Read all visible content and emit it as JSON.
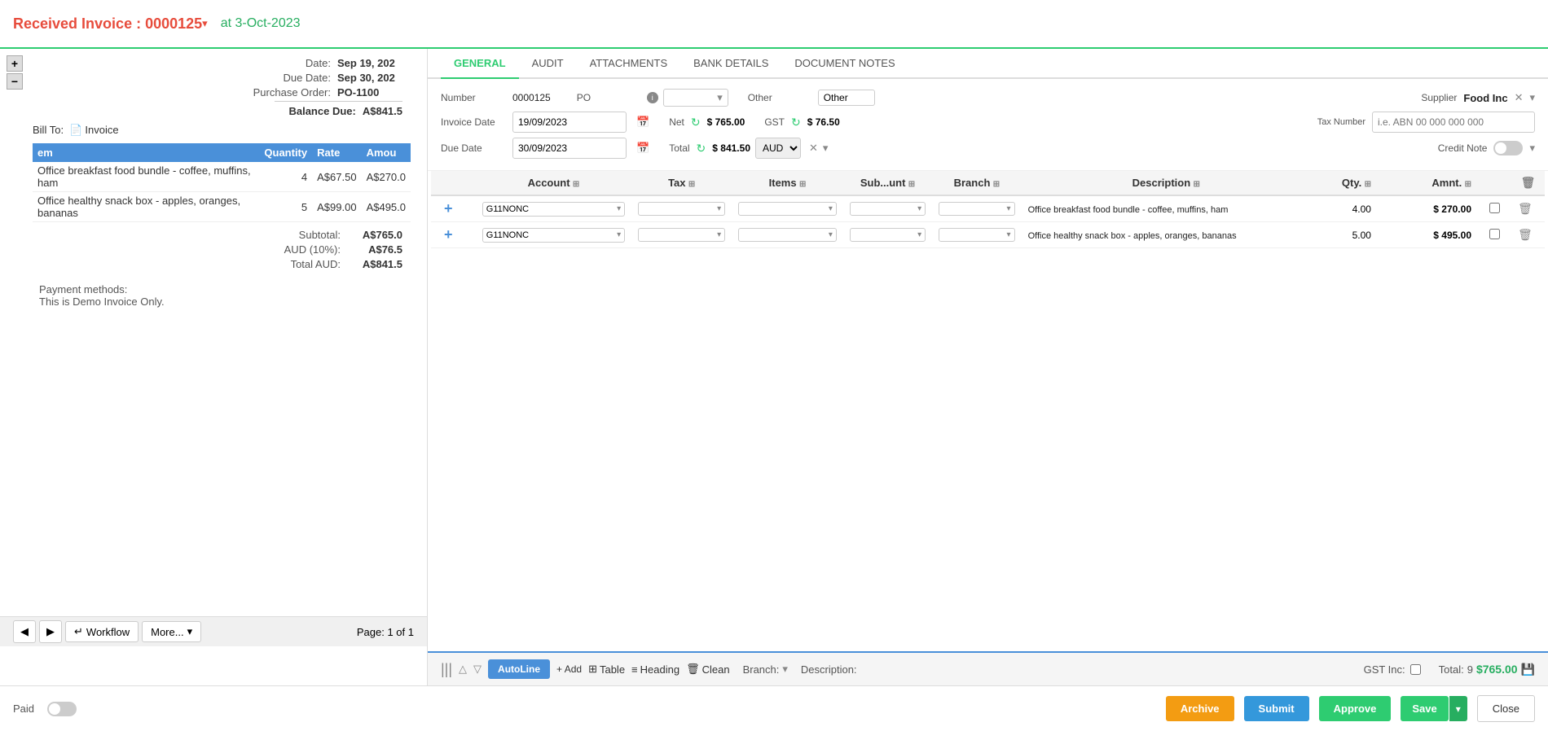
{
  "header": {
    "title": "Received Invoice : 0000125",
    "title_dropdown_symbol": "▾",
    "date": "at 3-Oct-2023"
  },
  "tabs": {
    "items": [
      "GENERAL",
      "AUDIT",
      "ATTACHMENTS",
      "BANK DETAILS",
      "DOCUMENT NOTES"
    ],
    "active": "GENERAL"
  },
  "form": {
    "number_label": "Number",
    "number_value": "0000125",
    "po_label": "PO",
    "po_info": "i",
    "other_label": "Other",
    "other_value": "Other",
    "supplier_label": "Supplier",
    "supplier_value": "Food Inc",
    "invoice_date_label": "Invoice Date",
    "invoice_date_value": "19/09/2023",
    "net_label": "Net",
    "net_value": "$ 765.00",
    "gst_label": "GST",
    "gst_value": "$ 76.50",
    "tax_number_label": "Tax Number",
    "tax_number_placeholder": "i.e. ABN 00 000 000 000",
    "due_date_label": "Due Date",
    "due_date_value": "30/09/2023",
    "total_label": "Total",
    "total_value": "$ 841.50",
    "currency_value": "AUD",
    "credit_note_label": "Credit Note"
  },
  "line_items": {
    "columns": [
      "Account",
      "Tax",
      "Items",
      "Sub...unt",
      "Branch",
      "Description",
      "Qty.",
      "Amnt."
    ],
    "rows": [
      {
        "account": "G11NONC",
        "tax": "",
        "items": "",
        "subaccount": "",
        "branch": "",
        "description": "Office breakfast food bundle - coffee, muffins, ham",
        "qty": "4.00",
        "amount": "$ 270.00"
      },
      {
        "account": "G11NONC",
        "tax": "",
        "items": "",
        "subaccount": "",
        "branch": "",
        "description": "Office healthy snack box - apples, oranges, bananas",
        "qty": "5.00",
        "amount": "$ 495.00"
      }
    ]
  },
  "bottom_toolbar": {
    "handle": "|||",
    "autoline_label": "AutoLine",
    "add_label": "+ Add",
    "table_label": "Table",
    "heading_label": "Heading",
    "clean_label": "Clean",
    "branch_label": "Branch:",
    "description_label": "Description:",
    "gst_inc_label": "GST Inc:",
    "total_label": "Total:",
    "total_qty": "9",
    "total_amount": "$765.00"
  },
  "left_panel": {
    "bill_to_label": "Bill To:",
    "invoice_label": "Invoice",
    "date_label": "Date:",
    "date_value": "Sep 19, 202",
    "due_date_label": "Due Date:",
    "due_date_value": "Sep 30, 202",
    "purchase_order_label": "Purchase Order:",
    "purchase_order_value": "PO-1100",
    "balance_due_label": "Balance Due:",
    "balance_due_value": "A$841.5",
    "table_headers": [
      "em",
      "Quantity",
      "Rate",
      "Amou"
    ],
    "table_rows": [
      {
        "item": "Office breakfast food bundle - coffee, muffins, ham",
        "qty": "4",
        "rate": "A$67.50",
        "amount": "A$270.0"
      },
      {
        "item": "Office healthy snack box - apples, oranges, bananas",
        "qty": "5",
        "rate": "A$99.00",
        "amount": "A$495.0"
      }
    ],
    "subtotal_label": "Subtotal:",
    "subtotal_value": "A$765.0",
    "aud_tax_label": "AUD (10%):",
    "aud_tax_value": "A$76.5",
    "total_aud_label": "Total AUD:",
    "total_aud_value": "A$841.5",
    "payment_methods_label": "Payment methods:",
    "payment_note": "This is Demo Invoice Only.",
    "page_label": "Page: 1 of 1"
  },
  "action_bar": {
    "paid_label": "Paid",
    "archive_label": "Archive",
    "submit_label": "Submit",
    "approve_label": "Approve",
    "save_label": "Save",
    "close_label": "Close"
  },
  "nav": {
    "workflow_label": "Workflow",
    "more_label": "More..."
  }
}
